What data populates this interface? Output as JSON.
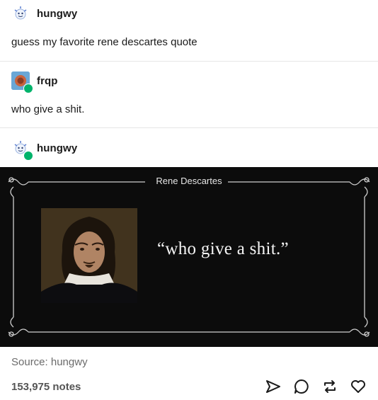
{
  "thread": [
    {
      "username": "hungwy",
      "text": "guess my favorite rene descartes quote"
    },
    {
      "username": "frqp",
      "text": "who give a shit."
    },
    {
      "username": "hungwy",
      "text": ""
    }
  ],
  "quote_image": {
    "author": "Rene Descartes",
    "quote": "“who give a shit.”"
  },
  "footer": {
    "source_label": "Source:",
    "source_name": "hungwy",
    "notes": "153,975 notes"
  },
  "icons": {
    "share": "send-icon",
    "reply": "reply-icon",
    "reblog": "reblog-icon",
    "like": "heart-icon"
  },
  "colors": {
    "reblog_badge": "#00b36b",
    "divider": "#e6e6e6",
    "image_background": "#0c0c0c"
  }
}
